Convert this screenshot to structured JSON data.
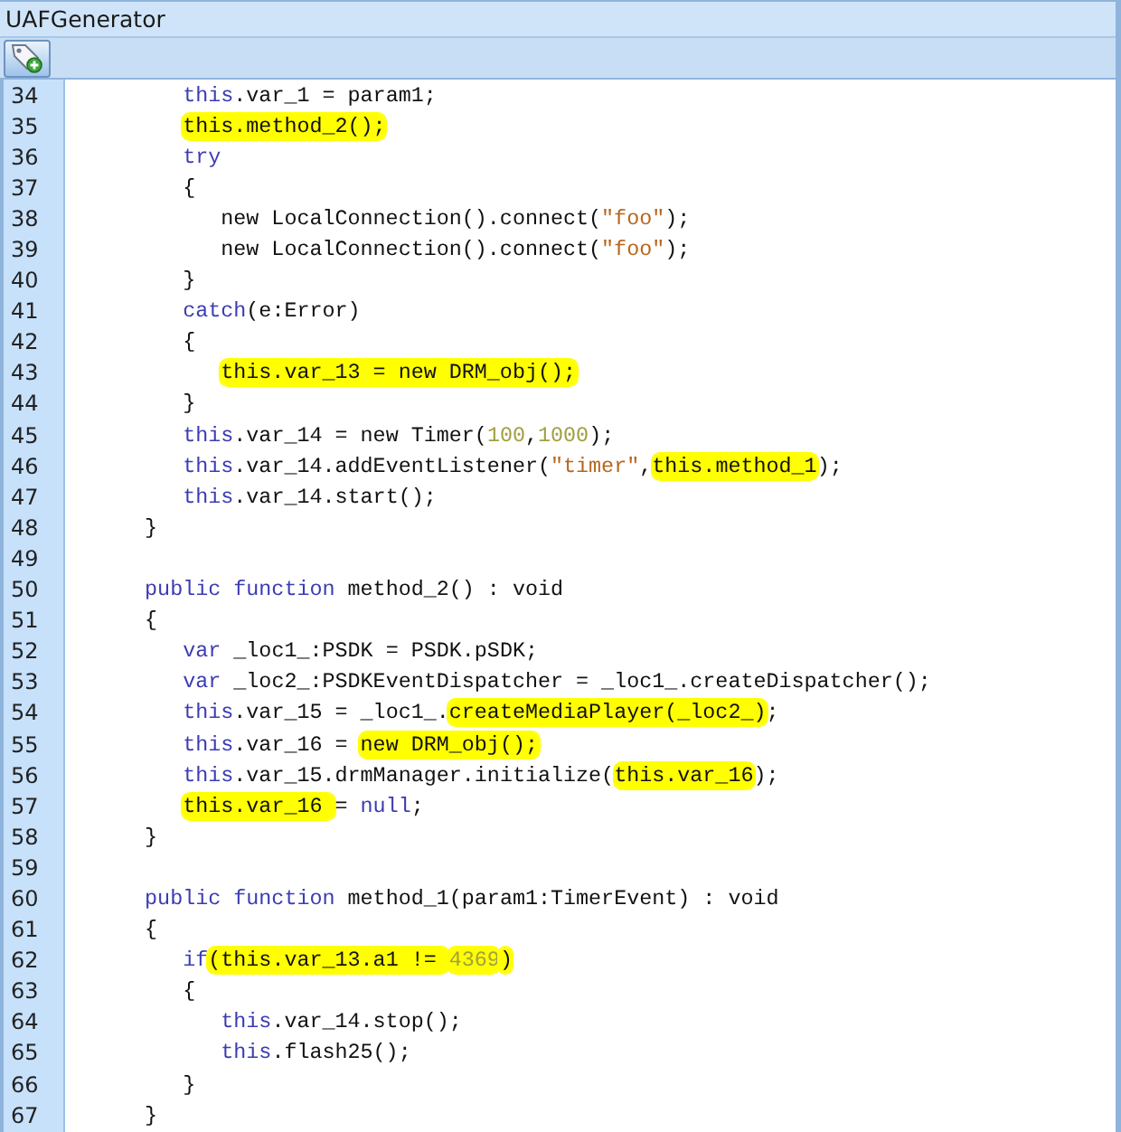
{
  "window": {
    "title": "UAFGenerator"
  },
  "toolbar": {
    "buttons": [
      {
        "kind": "add-tag"
      }
    ]
  },
  "editor": {
    "lines": [
      {
        "number": "34",
        "segments": [
          {
            "text": "      this",
            "kind": "kw",
            "highlighted": false
          },
          {
            "text": ".var_1 = param1;",
            "kind": "plain",
            "highlighted": false
          }
        ]
      },
      {
        "number": "35",
        "segments": [
          {
            "text": "      this.method_2();",
            "kind": "plain",
            "highlighted": true
          }
        ]
      },
      {
        "number": "36",
        "segments": [
          {
            "text": "      try",
            "kind": "kw",
            "highlighted": false
          }
        ]
      },
      {
        "number": "37",
        "segments": [
          {
            "text": "      {",
            "kind": "plain",
            "highlighted": false
          }
        ]
      },
      {
        "number": "38",
        "segments": [
          {
            "text": "         new LocalConnection().connect(",
            "kind": "plain",
            "highlighted": false
          },
          {
            "text": "\"foo\"",
            "kind": "str",
            "highlighted": false
          },
          {
            "text": ");",
            "kind": "plain",
            "highlighted": false
          }
        ]
      },
      {
        "number": "39",
        "segments": [
          {
            "text": "         new LocalConnection().connect(",
            "kind": "plain",
            "highlighted": false
          },
          {
            "text": "\"foo\"",
            "kind": "str",
            "highlighted": false
          },
          {
            "text": ");",
            "kind": "plain",
            "highlighted": false
          }
        ]
      },
      {
        "number": "40",
        "segments": [
          {
            "text": "      }",
            "kind": "plain",
            "highlighted": false
          }
        ]
      },
      {
        "number": "41",
        "segments": [
          {
            "text": "      catch",
            "kind": "kw",
            "highlighted": false
          },
          {
            "text": "(e:Error)",
            "kind": "plain",
            "highlighted": false
          }
        ]
      },
      {
        "number": "42",
        "segments": [
          {
            "text": "      {",
            "kind": "plain",
            "highlighted": false
          }
        ]
      },
      {
        "number": "43",
        "segments": [
          {
            "text": "         this.var_13 = new DRM_obj();",
            "kind": "plain",
            "highlighted": true
          }
        ]
      },
      {
        "number": "44",
        "segments": [
          {
            "text": "      }",
            "kind": "plain",
            "highlighted": false
          }
        ]
      },
      {
        "number": "45",
        "segments": [
          {
            "text": "      this",
            "kind": "kw",
            "highlighted": false
          },
          {
            "text": ".var_14 = new Timer(",
            "kind": "plain",
            "highlighted": false
          },
          {
            "text": "100",
            "kind": "num",
            "highlighted": false
          },
          {
            "text": ",",
            "kind": "plain",
            "highlighted": false
          },
          {
            "text": "1000",
            "kind": "num",
            "highlighted": false
          },
          {
            "text": ");",
            "kind": "plain",
            "highlighted": false
          }
        ]
      },
      {
        "number": "46",
        "segments": [
          {
            "text": "      this",
            "kind": "kw",
            "highlighted": false
          },
          {
            "text": ".var_14.addEventListener(",
            "kind": "plain",
            "highlighted": false
          },
          {
            "text": "\"timer\"",
            "kind": "str",
            "highlighted": false
          },
          {
            "text": ",",
            "kind": "plain",
            "highlighted": false
          },
          {
            "text": "this.method_1",
            "kind": "plain",
            "highlighted": true
          },
          {
            "text": ");",
            "kind": "plain",
            "highlighted": false
          }
        ]
      },
      {
        "number": "47",
        "segments": [
          {
            "text": "      this",
            "kind": "kw",
            "highlighted": false
          },
          {
            "text": ".var_14.start();",
            "kind": "plain",
            "highlighted": false
          }
        ]
      },
      {
        "number": "48",
        "segments": [
          {
            "text": "   }",
            "kind": "plain",
            "highlighted": false
          }
        ]
      },
      {
        "number": "49"
      },
      {
        "number": "50",
        "segments": [
          {
            "text": "   public function",
            "kind": "kw",
            "highlighted": false
          },
          {
            "text": " method_2() : void",
            "kind": "plain",
            "highlighted": false
          }
        ]
      },
      {
        "number": "51",
        "segments": [
          {
            "text": "   {",
            "kind": "plain",
            "highlighted": false
          }
        ]
      },
      {
        "number": "52",
        "segments": [
          {
            "text": "      var",
            "kind": "kw",
            "highlighted": false
          },
          {
            "text": " _loc1_:PSDK = PSDK.pSDK;",
            "kind": "plain",
            "highlighted": false
          }
        ]
      },
      {
        "number": "53",
        "segments": [
          {
            "text": "      var",
            "kind": "kw",
            "highlighted": false
          },
          {
            "text": " _loc2_:PSDKEventDispatcher = _loc1_.createDispatcher();",
            "kind": "plain",
            "highlighted": false
          }
        ]
      },
      {
        "number": "54",
        "segments": [
          {
            "text": "      this",
            "kind": "kw",
            "highlighted": false
          },
          {
            "text": ".var_15 = _loc1_.",
            "kind": "plain",
            "highlighted": false
          },
          {
            "text": "createMediaPlayer(_loc2_)",
            "kind": "plain",
            "highlighted": true
          },
          {
            "text": ";",
            "kind": "plain",
            "highlighted": false
          }
        ]
      },
      {
        "number": "55",
        "segments": [
          {
            "text": "      this",
            "kind": "kw",
            "highlighted": false
          },
          {
            "text": ".var_16 =",
            "kind": "plain",
            "highlighted": false
          },
          {
            "text": " new DRM_obj();",
            "kind": "plain",
            "highlighted": true
          }
        ]
      },
      {
        "number": "56",
        "segments": [
          {
            "text": "      this",
            "kind": "kw",
            "highlighted": false
          },
          {
            "text": ".var_15.drmManager.initialize(",
            "kind": "plain",
            "highlighted": false
          },
          {
            "text": "this.var_16",
            "kind": "plain",
            "highlighted": true
          },
          {
            "text": ");",
            "kind": "plain",
            "highlighted": false
          }
        ]
      },
      {
        "number": "57",
        "segments": [
          {
            "text": "      this.var_16 ",
            "kind": "plain",
            "highlighted": true
          },
          {
            "text": "= ",
            "kind": "plain",
            "highlighted": false
          },
          {
            "text": "null",
            "kind": "kw",
            "highlighted": false
          },
          {
            "text": ";",
            "kind": "plain",
            "highlighted": false
          }
        ]
      },
      {
        "number": "58",
        "segments": [
          {
            "text": "   }",
            "kind": "plain",
            "highlighted": false
          }
        ]
      },
      {
        "number": "59"
      },
      {
        "number": "60",
        "segments": [
          {
            "text": "   public function",
            "kind": "kw",
            "highlighted": false
          },
          {
            "text": " method_1(param1:TimerEvent) : void",
            "kind": "plain",
            "highlighted": false
          }
        ]
      },
      {
        "number": "61",
        "segments": [
          {
            "text": "   {",
            "kind": "plain",
            "highlighted": false
          }
        ]
      },
      {
        "number": "62",
        "segments": [
          {
            "text": "      if",
            "kind": "kw",
            "highlighted": false
          },
          {
            "text": "(this.var_13.a1 != ",
            "kind": "plain",
            "highlighted": true
          },
          {
            "text": "4369",
            "kind": "num",
            "highlighted": true
          },
          {
            "text": ")",
            "kind": "plain",
            "highlighted": true
          }
        ]
      },
      {
        "number": "63",
        "segments": [
          {
            "text": "      {",
            "kind": "plain",
            "highlighted": false
          }
        ]
      },
      {
        "number": "64",
        "segments": [
          {
            "text": "         this",
            "kind": "kw",
            "highlighted": false
          },
          {
            "text": ".var_14.stop();",
            "kind": "plain",
            "highlighted": false
          }
        ]
      },
      {
        "number": "65",
        "segments": [
          {
            "text": "         this",
            "kind": "kw",
            "highlighted": false
          },
          {
            "text": ".flash25();",
            "kind": "plain",
            "highlighted": false
          }
        ]
      },
      {
        "number": "66",
        "segments": [
          {
            "text": "      }",
            "kind": "plain",
            "highlighted": false
          }
        ]
      },
      {
        "number": "67",
        "segments": [
          {
            "text": "   }",
            "kind": "plain",
            "highlighted": false
          }
        ]
      }
    ]
  }
}
